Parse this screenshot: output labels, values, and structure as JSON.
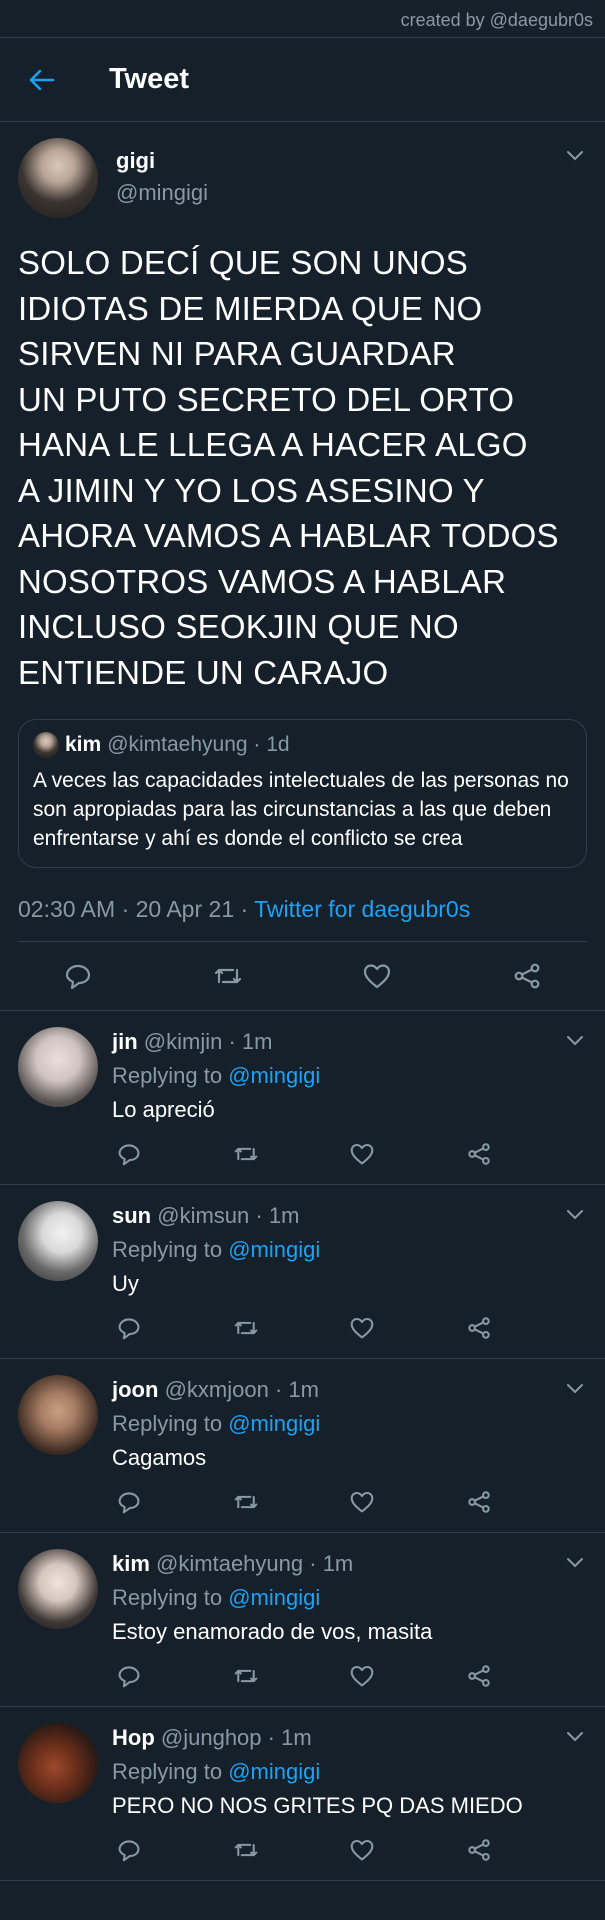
{
  "credit": "created by @daegubr0s",
  "header": {
    "title": "Tweet"
  },
  "main_tweet": {
    "display_name": "gigi",
    "handle": "@mingigi",
    "text": "SOLO DECÍ QUE SON UNOS\nIDIOTAS DE MIERDA QUE NO\nSIRVEN NI PARA GUARDAR\nUN PUTO SECRETO DEL ORTO\nHANA LE LLEGA A HACER ALGO\nA JIMIN Y YO LOS ASESINO Y\nAHORA VAMOS A HABLAR TODOS\nNOSOTROS VAMOS A HABLAR\nINCLUSO SEOKJIN QUE NO\nENTIENDE UN CARAJO",
    "quote": {
      "display_name": "kim",
      "handle": "@kimtaehyung",
      "time": "1d",
      "text": "A veces las capacidades intelectuales de las personas no son apropiadas para las circunstancias a las que deben enfrentarse y ahí es donde el conflicto se crea"
    },
    "time": "02:30 AM",
    "date": "20 Apr 21",
    "source": "Twitter for daegubr0s"
  },
  "replying_to_label": "Replying to",
  "replies": [
    {
      "display_name": "jin",
      "handle": "@kimjin",
      "time": "1m",
      "mention": "@mingigi",
      "text": "Lo apreció"
    },
    {
      "display_name": "sun",
      "handle": "@kimsun",
      "time": "1m",
      "mention": "@mingigi",
      "text": "Uy"
    },
    {
      "display_name": "joon",
      "handle": "@kxmjoon",
      "time": "1m",
      "mention": "@mingigi",
      "text": "Cagamos"
    },
    {
      "display_name": "kim",
      "handle": "@kimtaehyung",
      "time": "1m",
      "mention": "@mingigi",
      "text": "Estoy enamorado de vos, masita"
    },
    {
      "display_name": "Hop",
      "handle": "@junghop",
      "time": "1m",
      "mention": "@mingigi",
      "text": "PERO NO NOS GRITES PQ DAS MIEDO"
    }
  ],
  "colors": {
    "background": "#15202b",
    "accent": "#1da1f2",
    "muted": "#8899a6",
    "border": "#2f3e4c"
  },
  "icons": [
    "back-arrow-icon",
    "chevron-down-icon",
    "reply-icon",
    "retweet-icon",
    "like-icon",
    "share-icon"
  ]
}
